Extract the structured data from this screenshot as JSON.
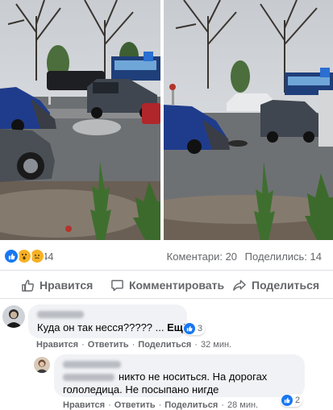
{
  "post": {
    "reactions": {
      "icons": [
        "like-icon",
        "wow-icon",
        "sad-icon"
      ],
      "count": "44"
    },
    "comments_count": "Коментари: 20",
    "shares_count": "Поделились: 14"
  },
  "actions": {
    "like_label": "Нравится",
    "comment_label": "Комментировать",
    "share_label": "Поделиться"
  },
  "comments": [
    {
      "text": "Куда он так несся????? ...",
      "more_label": "Ещё",
      "reactions": "3",
      "like": "Нравится",
      "reply": "Ответить",
      "share": "Поделиться",
      "sep": "·",
      "time": "32 мин."
    },
    {
      "text_line1": "никто не носиться. На дорогах",
      "text_line2": "гололедица. Не посыпано нигде",
      "reactions": "2",
      "like": "Нравится",
      "reply": "Ответить",
      "share": "Поделиться",
      "sep": "·",
      "time": "28 мин."
    }
  ],
  "colors": {
    "accent": "#1877f2",
    "muted": "#65676b",
    "bubble": "#f0f2f5"
  }
}
